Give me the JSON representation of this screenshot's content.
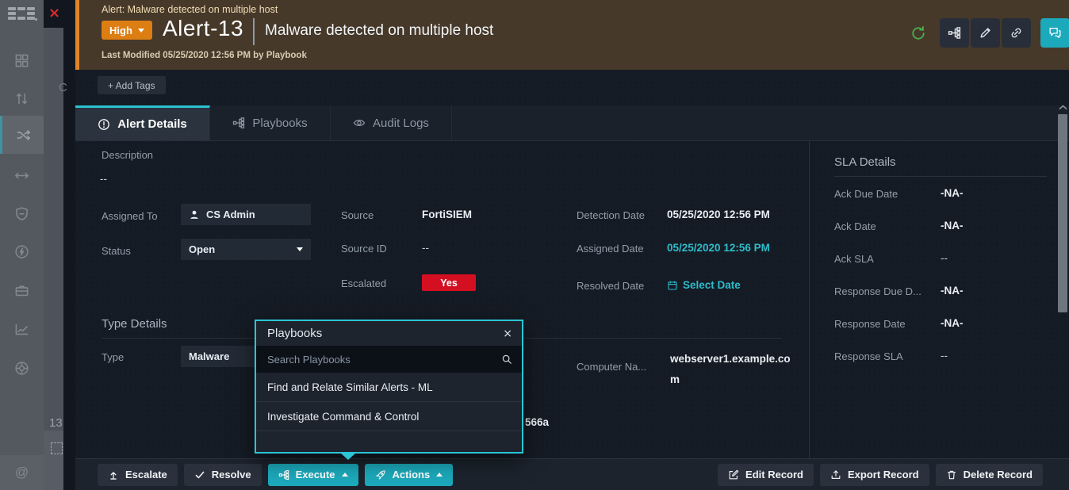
{
  "colors": {
    "accent_teal": "#2bc5d6",
    "accent_orange": "#e08428",
    "severity_orange": "#dd7e12",
    "escalated_red": "#d30f21",
    "link_teal": "#2fbccb",
    "refresh_green": "#49ab4e"
  },
  "overlay": {
    "close": "×",
    "partial_c": "C",
    "row_number": "13"
  },
  "sidebar": {
    "mentions": "@"
  },
  "header": {
    "breadcrumb": "Alert: Malware detected on multiple host",
    "severity": "High",
    "alert_id": "Alert-13",
    "title": "Malware detected on multiple host",
    "last_modified": "Last Modified 05/25/2020 12:56 PM by Playbook"
  },
  "tags": {
    "add_label": "+ Add Tags"
  },
  "tabs": [
    {
      "label": "Alert Details"
    },
    {
      "label": "Playbooks"
    },
    {
      "label": "Audit Logs"
    }
  ],
  "details": {
    "description": {
      "label": "Description",
      "value": "--"
    },
    "assigned_to": {
      "label": "Assigned To",
      "value": "CS Admin"
    },
    "status": {
      "label": "Status",
      "value": "Open"
    },
    "source": {
      "label": "Source",
      "value": "FortiSIEM"
    },
    "source_id": {
      "label": "Source ID",
      "value": "--"
    },
    "escalated": {
      "label": "Escalated",
      "value": "Yes"
    },
    "detection_date": {
      "label": "Detection Date",
      "value": "05/25/2020 12:56 PM"
    },
    "assigned_date": {
      "label": "Assigned Date",
      "value": "05/25/2020 12:56 PM"
    },
    "resolved_date": {
      "label": "Resolved Date",
      "value": "Select Date"
    }
  },
  "type_details": {
    "heading": "Type Details",
    "type": {
      "label": "Type",
      "value": "Malware"
    },
    "computer_name": {
      "label": "Computer Na...",
      "value": "webserver1.example.com"
    },
    "partial_hash": "566a"
  },
  "sla": {
    "heading": "SLA Details",
    "rows": [
      {
        "label": "Ack Due Date",
        "value": "-NA-"
      },
      {
        "label": "Ack Date",
        "value": "-NA-"
      },
      {
        "label": "Ack SLA",
        "value": "--"
      },
      {
        "label": "Response Due D...",
        "value": "-NA-"
      },
      {
        "label": "Response Date",
        "value": "-NA-"
      },
      {
        "label": "Response SLA",
        "value": "--"
      }
    ]
  },
  "popup": {
    "title": "Playbooks",
    "close": "×",
    "search_placeholder": "Search Playbooks",
    "items": [
      {
        "label": "Find and Relate Similar Alerts - ML"
      },
      {
        "label": "Investigate Command & Control"
      }
    ]
  },
  "footer": {
    "escalate": "Escalate",
    "resolve": "Resolve",
    "execute": "Execute",
    "actions": "Actions",
    "edit": "Edit Record",
    "export": "Export Record",
    "delete": "Delete Record"
  }
}
